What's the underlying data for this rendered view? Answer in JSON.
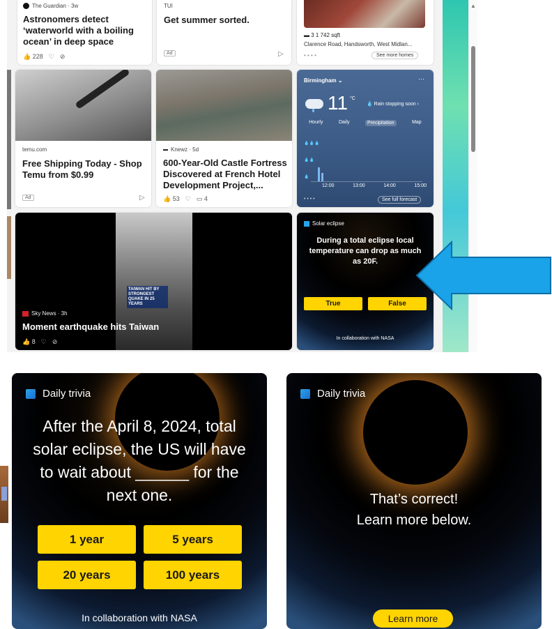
{
  "feed": {
    "guardian": {
      "source": "The Guardian · 3w",
      "title_lines": [
        "Astronomers detect",
        "‘waterworld with a boiling",
        "ocean’ in deep space"
      ],
      "likes": "228"
    },
    "tui": {
      "source": "TUI",
      "title": "Get summer sorted.",
      "ad_label": "Ad"
    },
    "home": {
      "specs": "3  1  742 sqft",
      "address": "Clarence Road, Handsworth, West Midlan...",
      "see_more": "See more homes"
    },
    "temu": {
      "source": "temu.com",
      "title_lines": [
        "Free Shipping Today - Shop",
        "Temu from $0.99"
      ],
      "ad_label": "Ad"
    },
    "castle": {
      "source": "Knewz · 5d",
      "title_lines": [
        "600-Year-Old Castle Fortress",
        "Discovered at French Hotel",
        "Development Project,..."
      ],
      "likes": "53",
      "comments": "4"
    },
    "weather": {
      "location": "Birmingham",
      "temp": "11",
      "unit": "°C",
      "rain_note": "Rain stopping soon",
      "tabs": [
        "Hourly",
        "Daily",
        "Precipitation",
        "Map"
      ],
      "times": [
        "12:00",
        "13:00",
        "14:00",
        "15:00"
      ],
      "forecast_link": "See full forecast"
    },
    "skynews": {
      "source": "Sky News · 3h",
      "title": "Moment earthquake hits Taiwan",
      "likes": "8",
      "overlay_text": "TAIWAN HIT BY STRONGEST QUAKE IN 25 YEARS"
    },
    "eclipse_small": {
      "label": "Solar eclipse",
      "question": "During a total eclipse local temperature can drop as much as 20F.",
      "true_label": "True",
      "false_label": "False",
      "collab": "In collaboration with NASA"
    }
  },
  "trivia_left": {
    "label": "Daily trivia",
    "question_lines": [
      "After the April 8, 2024, total",
      "solar eclipse, the US will have",
      "to wait about ______ for the",
      "next one."
    ],
    "options": [
      "1 year",
      "5 years",
      "20 years",
      "100 years"
    ],
    "collab": "In collaboration with NASA"
  },
  "trivia_right": {
    "label": "Daily trivia",
    "result_line1": "That’s correct!",
    "result_line2": "Learn more below.",
    "learn_more": "Learn more"
  },
  "colors": {
    "accent_yellow": "#ffd400",
    "arrow_blue": "#1aa3e8",
    "weather_bg": "#3b5a85"
  }
}
